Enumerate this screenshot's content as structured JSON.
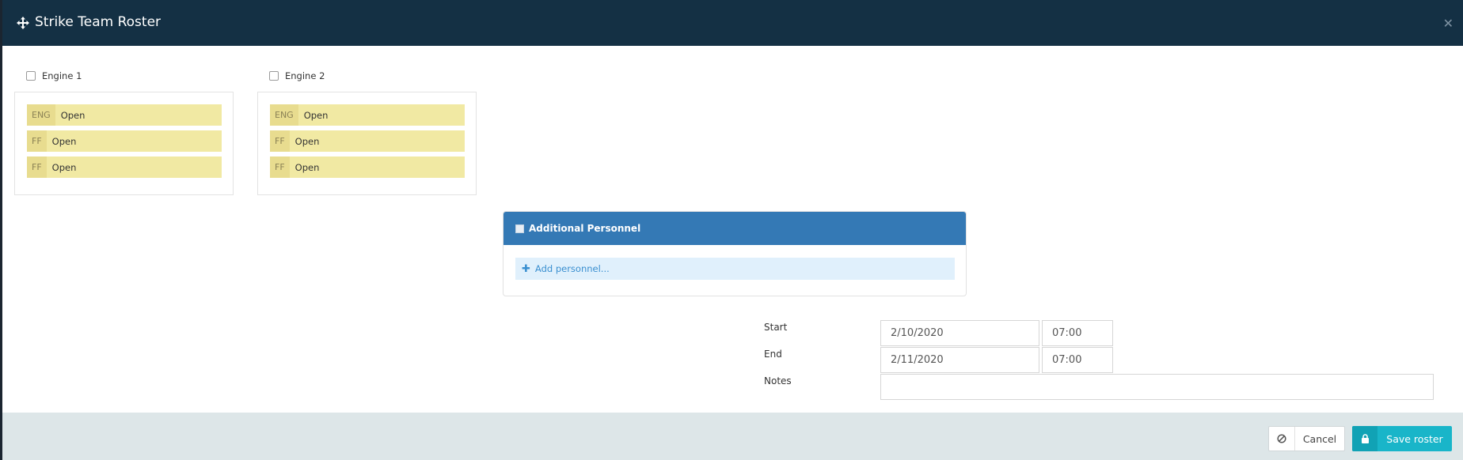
{
  "dialog": {
    "title": "Strike Team Roster",
    "icon": "crosshair-move-icon",
    "close_icon": "close-icon"
  },
  "engines": [
    {
      "label": "Engine 1",
      "checked": false,
      "slots": [
        {
          "role": "ENG",
          "status": "Open"
        },
        {
          "role": "FF",
          "status": "Open"
        },
        {
          "role": "FF",
          "status": "Open"
        }
      ]
    },
    {
      "label": "Engine 2",
      "checked": false,
      "slots": [
        {
          "role": "ENG",
          "status": "Open"
        },
        {
          "role": "FF",
          "status": "Open"
        },
        {
          "role": "FF",
          "status": "Open"
        }
      ]
    }
  ],
  "additional_personnel": {
    "title": "Additional Personnel",
    "checked": false,
    "add_label": "Add personnel..."
  },
  "form": {
    "start_label": "Start",
    "start_date": "2/10/2020",
    "start_time": "07:00",
    "end_label": "End",
    "end_date": "2/11/2020",
    "end_time": "07:00",
    "notes_label": "Notes",
    "notes_value": ""
  },
  "footer": {
    "cancel_label": "Cancel",
    "cancel_icon": "ban-icon",
    "save_label": "Save roster",
    "save_icon": "lock-icon"
  },
  "colors": {
    "header_bg": "#143044",
    "slot_bg": "#f1e9a3",
    "panel_header": "#3479b5",
    "add_row_bg": "#e0f0fc",
    "save_button": "#19b5c9",
    "footer_bg": "#dde6e8"
  }
}
